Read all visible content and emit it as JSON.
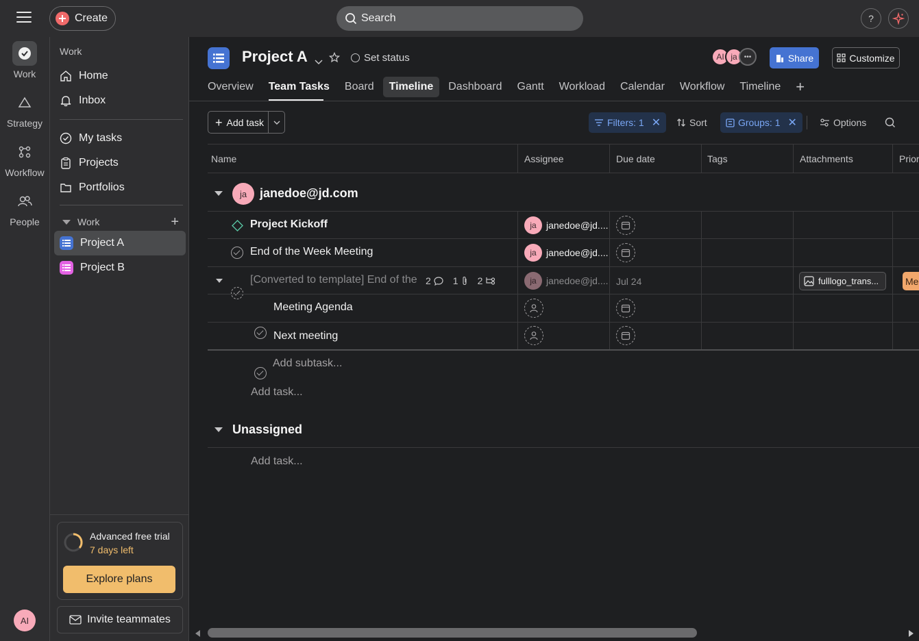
{
  "topbar": {
    "create_label": "Create",
    "search_label": "Search",
    "help_label": "?"
  },
  "rail": {
    "items": [
      {
        "label": "Work",
        "icon": "check-circle-icon"
      },
      {
        "label": "Strategy",
        "icon": "triangle-icon"
      },
      {
        "label": "Workflow",
        "icon": "workflow-icon"
      },
      {
        "label": "People",
        "icon": "people-icon"
      }
    ],
    "user_initials": "AI"
  },
  "sidebar": {
    "section_title": "Work",
    "top_items": [
      {
        "label": "Home",
        "icon": "home-icon"
      },
      {
        "label": "Inbox",
        "icon": "bell-icon"
      }
    ],
    "mid_items": [
      {
        "label": "My tasks",
        "icon": "check-circle-icon"
      },
      {
        "label": "Projects",
        "icon": "clipboard-icon"
      },
      {
        "label": "Portfolios",
        "icon": "folder-icon"
      }
    ],
    "work_group_label": "Work",
    "projects": [
      {
        "label": "Project A",
        "color": "#4573d2"
      },
      {
        "label": "Project B",
        "color": "#e362e3"
      }
    ],
    "trial": {
      "title": "Advanced free trial",
      "days_left": "7 days left",
      "explore_label": "Explore plans"
    },
    "invite_label": "Invite teammates"
  },
  "project": {
    "title": "Project A",
    "set_status_label": "Set status",
    "members": [
      "AI",
      "ja"
    ],
    "share_label": "Share",
    "customize_label": "Customize",
    "tabs": [
      "Overview",
      "Team Tasks",
      "Board",
      "Timeline",
      "Dashboard",
      "Gantt",
      "Workload",
      "Calendar",
      "Workflow",
      "Timeline"
    ]
  },
  "toolbar": {
    "add_task_label": "Add task",
    "filters_label": "Filters: 1",
    "sort_label": "Sort",
    "groups_label": "Groups: 1",
    "options_label": "Options"
  },
  "table": {
    "columns": [
      "Name",
      "Assignee",
      "Due date",
      "Tags",
      "Attachments",
      "Prior"
    ],
    "groups": [
      {
        "name": "janedoe@jd.com",
        "avatar": "ja",
        "tasks": [
          {
            "name": "Project Kickoff",
            "assignee": "janedoe@jd....",
            "avatar": "ja",
            "due": "",
            "milestone": true
          },
          {
            "name": "End of the Week Meeting",
            "assignee": "janedoe@jd....",
            "avatar": "ja",
            "due": ""
          },
          {
            "name": "[Converted to template] End of the",
            "assignee": "janedoe@jd....",
            "avatar": "ja",
            "due": "Jul 24",
            "comments": "2",
            "attachments_count": "1",
            "subtasks_count": "2",
            "attachment": "fulllogo_trans...",
            "priority": "Me"
          }
        ],
        "subtasks": [
          {
            "name": "Meeting Agenda"
          },
          {
            "name": "Next meeting"
          }
        ],
        "add_subtask_label": "Add subtask...",
        "add_task_label": "Add task..."
      },
      {
        "name": "Unassigned",
        "add_task_label": "Add task..."
      }
    ]
  }
}
